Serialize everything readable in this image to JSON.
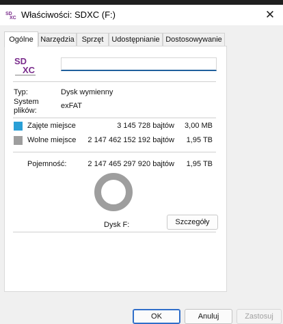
{
  "window": {
    "title": "Właściwości: SDXC (F:)",
    "app_icon_text": "SD XC"
  },
  "tabs": [
    {
      "label": "Ogólne",
      "active": true
    },
    {
      "label": "Narzędzia",
      "active": false
    },
    {
      "label": "Sprzęt",
      "active": false
    },
    {
      "label": "Udostępnianie",
      "active": false
    },
    {
      "label": "Dostosowywanie",
      "active": false
    }
  ],
  "general": {
    "drive_icon_text": "SD XC",
    "name_value": "",
    "type_label": "Typ:",
    "type_value": "Dysk wymienny",
    "fs_label_line1": "System",
    "fs_label_line2": "plików:",
    "fs_value": "exFAT",
    "used": {
      "label": "Zajęte miejsce",
      "bytes": "3 145 728 bajtów",
      "human": "3,00 MB",
      "color": "#2a9fd6"
    },
    "free": {
      "label": "Wolne miejsce",
      "bytes": "2 147 462 152 192 bajtów",
      "human": "1,95 TB",
      "color": "#9e9e9e"
    },
    "capacity": {
      "label": "Pojemność:",
      "bytes": "2 147 465 297 920 bajtów",
      "human": "1,95 TB"
    },
    "disk_label": "Dysk F:",
    "details_button": "Szczegóły"
  },
  "footer": {
    "ok": "OK",
    "cancel": "Anuluj",
    "apply": "Zastosuj"
  }
}
